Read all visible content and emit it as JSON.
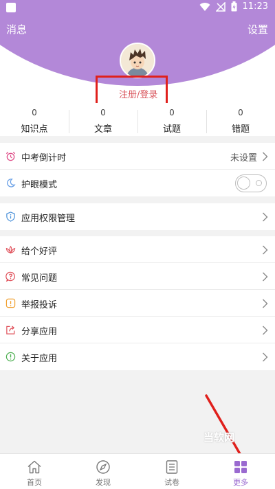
{
  "status_bar": {
    "time": "11:23"
  },
  "header": {
    "left_label": "消息",
    "right_label": "设置",
    "register_label": "注册/登录"
  },
  "stats": [
    {
      "value": "0",
      "label": "知识点"
    },
    {
      "value": "0",
      "label": "文章"
    },
    {
      "value": "0",
      "label": "试题"
    },
    {
      "value": "0",
      "label": "错题"
    }
  ],
  "menu": {
    "group1": [
      {
        "label": "中考倒计时",
        "value": "未设置",
        "icon": "alarm-clock-icon"
      },
      {
        "label": "护眼模式",
        "icon": "moon-icon",
        "toggle": "off"
      }
    ],
    "group2": [
      {
        "label": "应用权限管理",
        "icon": "shield-info-icon"
      }
    ],
    "group3": [
      {
        "label": "给个好评",
        "icon": "lotus-icon"
      },
      {
        "label": "常见问题",
        "icon": "question-icon"
      },
      {
        "label": "举报投诉",
        "icon": "warning-icon"
      },
      {
        "label": "分享应用",
        "icon": "share-icon"
      },
      {
        "label": "关于应用",
        "icon": "info-icon"
      }
    ]
  },
  "watermark": "当软网",
  "tabs": [
    {
      "label": "首页",
      "icon": "home-icon"
    },
    {
      "label": "发现",
      "icon": "compass-icon"
    },
    {
      "label": "试卷",
      "icon": "paper-icon"
    },
    {
      "label": "更多",
      "icon": "grid-icon",
      "active": true
    }
  ],
  "colors": {
    "header": "#b388d8",
    "accent": "#9a6ad0",
    "highlight_box": "#e0201c",
    "register_text": "#d8535a"
  }
}
